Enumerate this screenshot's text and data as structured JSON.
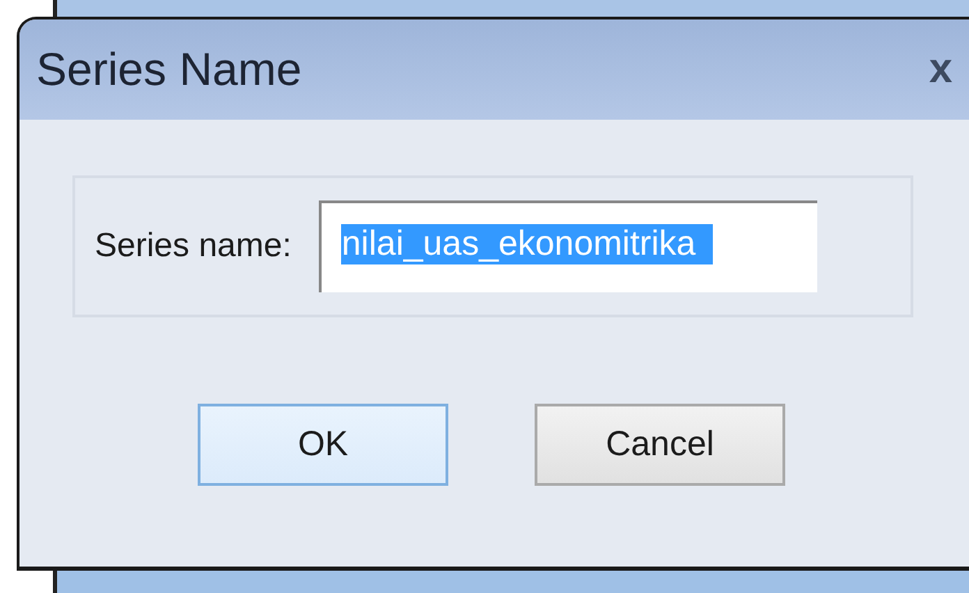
{
  "window": {
    "title": "Series Name",
    "close": "x"
  },
  "field": {
    "label": "Series name:",
    "value": "nilai_uas_ekonomitrika",
    "selected": true
  },
  "buttons": [
    {
      "label": "OK",
      "default": true
    },
    {
      "label": "Cancel",
      "default": false
    }
  ]
}
